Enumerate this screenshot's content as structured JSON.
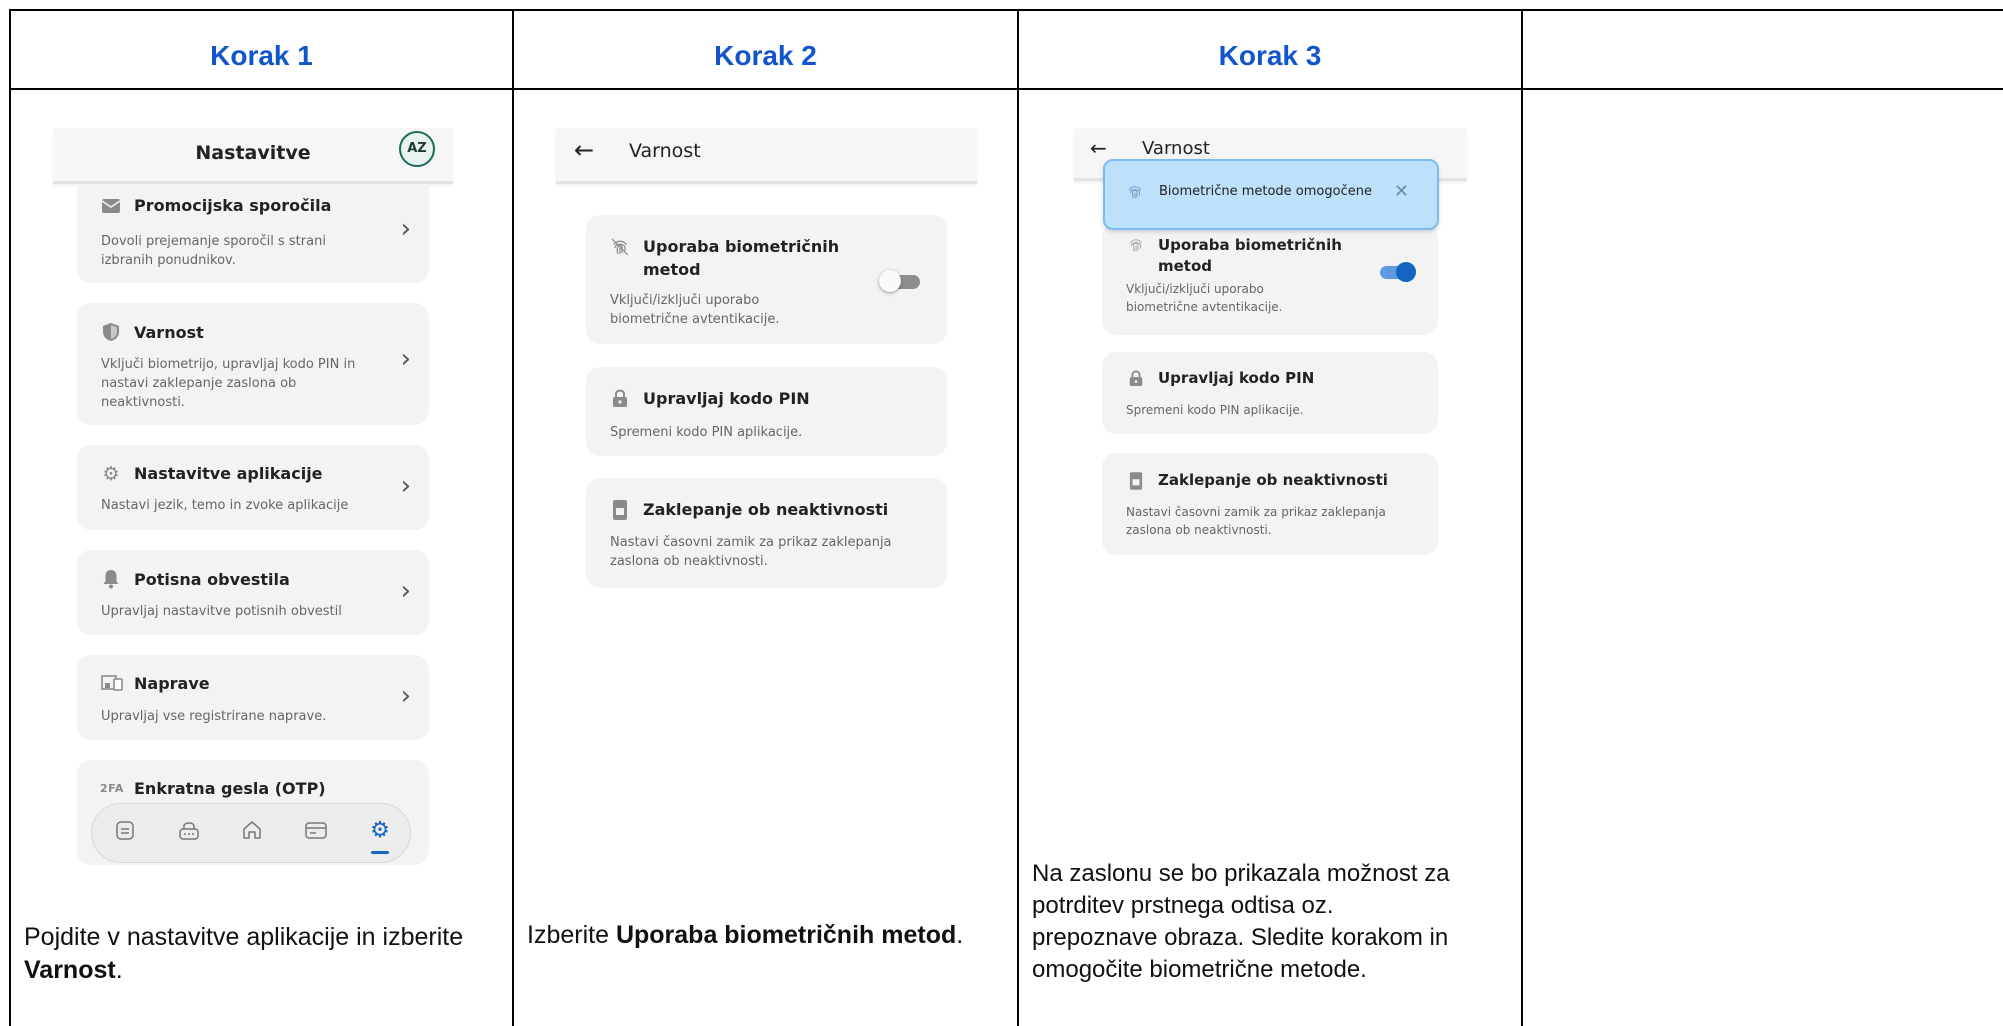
{
  "columns": [
    {
      "heading": "Korak 1"
    },
    {
      "heading": "Korak 2"
    },
    {
      "heading": "Korak 3"
    },
    {
      "heading": ""
    }
  ],
  "step1": {
    "screen_title": "Nastavitve",
    "avatar_initials": "AZ",
    "items": [
      {
        "icon": "envelope-icon",
        "title": "Promocijska sporočila",
        "desc_lines": [
          "Dovoli prejemanje sporočil s strani",
          "izbranih ponudnikov."
        ]
      },
      {
        "icon": "shield-icon",
        "title": "Varnost",
        "desc_lines": [
          "Vključi biometrijo, upravljaj kodo PIN in",
          "nastavi zaklepanje zaslona ob",
          "neaktivnosti."
        ]
      },
      {
        "icon": "gear-icon",
        "title": "Nastavitve aplikacije",
        "desc_lines": [
          "Nastavi jezik, temo in zvoke aplikacije"
        ]
      },
      {
        "icon": "bell-icon",
        "title": "Potisna obvestila",
        "desc_lines": [
          "Upravljaj nastavitve potisnih obvestil"
        ]
      },
      {
        "icon": "devices-icon",
        "title": "Naprave",
        "desc_lines": [
          "Upravljaj vse registrirane naprave."
        ]
      },
      {
        "icon": "2fa-icon",
        "icon_text": "2FA",
        "title": "Enkratna gesla (OTP)",
        "desc_lines": []
      }
    ],
    "nav": [
      "list-icon",
      "lock-icon",
      "home-icon",
      "card-icon",
      "gear-icon"
    ],
    "caption_plain": "Pojdite v nastavitve aplikacije in izberite ",
    "caption_bold": "Varnost",
    "caption_end": "."
  },
  "step2": {
    "screen_title": "Varnost",
    "biometric": {
      "title_lines": [
        "Uporaba biometričnih",
        "metod"
      ],
      "desc_lines": [
        "Vključi/izključi uporabo",
        "biometrične avtentikacije."
      ],
      "enabled": false
    },
    "pin": {
      "title": "Upravljaj kodo PIN",
      "desc": "Spremeni kodo PIN aplikacije."
    },
    "lock": {
      "title": "Zaklepanje ob neaktivnosti",
      "desc_lines": [
        "Nastavi časovni zamik za prikaz zaklepanja",
        "zaslona ob neaktivnosti."
      ]
    },
    "caption_plain": "Izberite ",
    "caption_bold": "Uporaba biometričnih metod",
    "caption_end": "."
  },
  "step3": {
    "screen_title": "Varnost",
    "toast": "Biometrične metode omogočene",
    "biometric": {
      "title_lines": [
        "Uporaba biometričnih",
        "metod"
      ],
      "desc_lines": [
        "Vključi/izključi uporabo",
        "biometrične avtentikacije."
      ],
      "enabled": true
    },
    "pin": {
      "title": "Upravljaj kodo PIN",
      "desc": "Spremeni kodo PIN aplikacije."
    },
    "lock": {
      "title": "Zaklepanje ob neaktivnosti",
      "desc_lines": [
        "Nastavi časovni zamik za prikaz zaklepanja",
        "zaslona ob neaktivnosti."
      ]
    },
    "caption_lines": [
      "Na zaslonu se bo prikazala možnost za",
      "potrditev prstnega odtisa oz.",
      "prepoznave obraza. Sledite korakom in",
      "omogočite biometrične metode."
    ]
  },
  "colors": {
    "heading": "#1155cc",
    "toggle_on": "#1565c0",
    "toast_bg": "#bde0fb"
  }
}
